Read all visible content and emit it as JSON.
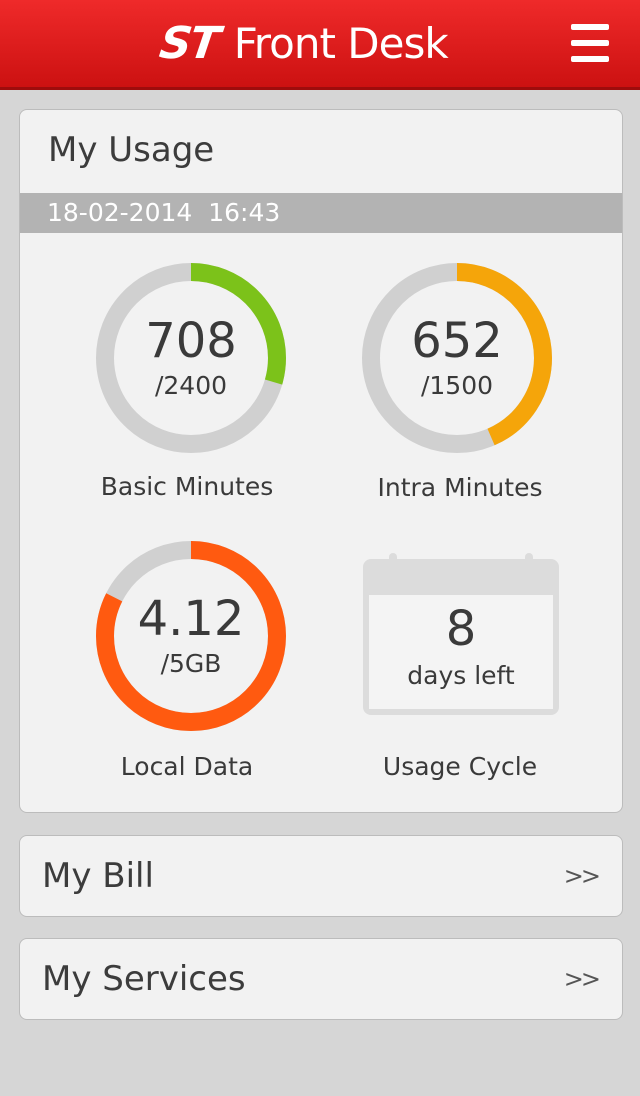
{
  "header": {
    "logo_mark": "ST",
    "app_title": "Front Desk",
    "menu_icon": "hamburger-menu-icon"
  },
  "usage": {
    "title": "My Usage",
    "date": "18-02-2014",
    "time": "16:43",
    "gauges": [
      {
        "label": "Basic Minutes",
        "value": "708",
        "total": "/2400",
        "fraction": 0.295,
        "color": "#7cc21a"
      },
      {
        "label": "Intra Minutes",
        "value": "652",
        "total": "/1500",
        "fraction": 0.435,
        "color": "#f5a50a"
      },
      {
        "label": "Local Data",
        "value": "4.12",
        "total": "/5GB",
        "fraction": 0.824,
        "color": "#ff5a10"
      }
    ],
    "cycle": {
      "label": "Usage Cycle",
      "days": "8",
      "days_text": "days left",
      "icon": "calendar-icon"
    }
  },
  "nav": {
    "bill_label": "My Bill",
    "services_label": "My Services",
    "chevron": ">>"
  },
  "colors": {
    "header_red": "#e01b1b",
    "track_gray": "#d0d0d0"
  }
}
